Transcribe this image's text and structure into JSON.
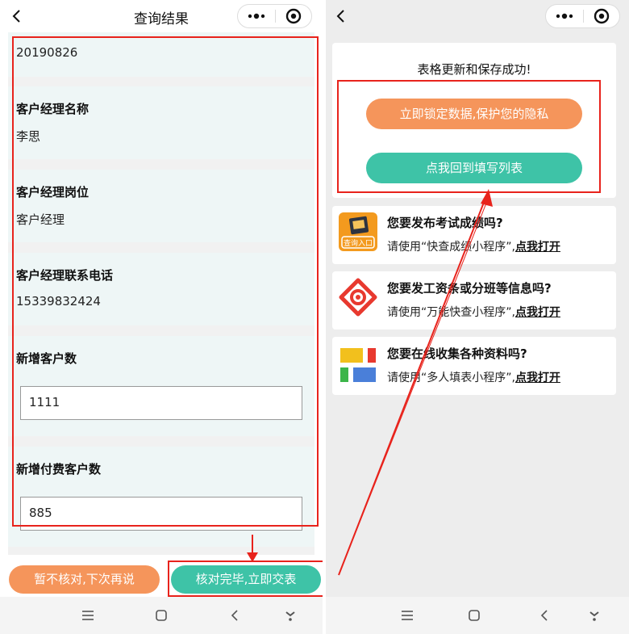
{
  "left": {
    "title": "查询结果",
    "fields": [
      {
        "value": "20190826"
      },
      {
        "label": "客户经理名称",
        "value": "李思"
      },
      {
        "label": "客户经理岗位",
        "value": "客户经理"
      },
      {
        "label": "客户经理联系电话",
        "value": "15339832424"
      },
      {
        "label": "新增客户数",
        "input": "1111"
      },
      {
        "label": "新增付费客户数",
        "input": "885"
      }
    ],
    "buttons": {
      "skip": "暂不核对,下次再说",
      "submit": "核对完毕,立即交表"
    }
  },
  "right": {
    "success_text": "表格更新和保存成功!",
    "lock_button": "立即锁定数据,保护您的隐私",
    "return_button": "点我回到填写列表",
    "promos": [
      {
        "icon": "query-score-app-icon",
        "icon_caption": "查询入口",
        "title": "您要发布考试成绩吗?",
        "desc_prefix": "请使用“快查成绩小程序”,",
        "link": "点我打开"
      },
      {
        "icon": "quick-query-app-icon",
        "title": "您要发工资条或分班等信息吗?",
        "desc_prefix": "请使用“万能快查小程序”,",
        "link": "点我打开"
      },
      {
        "icon": "form-collect-app-icon",
        "title": "您要在线收集各种资料吗?",
        "desc_prefix": "请使用“多人填表小程序”,",
        "link": "点我打开"
      }
    ]
  },
  "colors": {
    "accent_green": "#3ec3a7",
    "accent_orange": "#f5955b",
    "annotation_red": "#e8231c",
    "card_bg": "#eef6f6"
  }
}
